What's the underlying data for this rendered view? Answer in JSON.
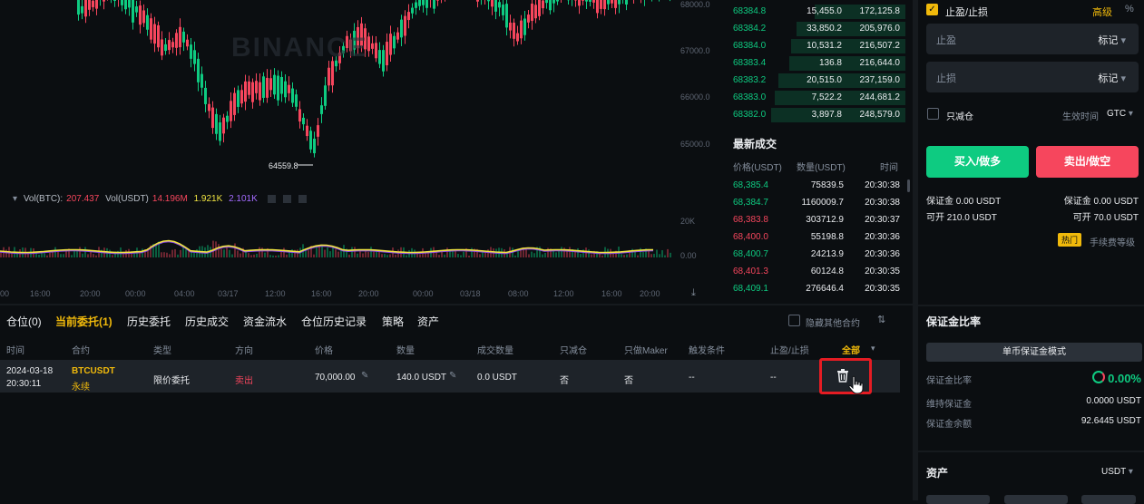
{
  "chart": {
    "price_ticks": [
      "68000.0",
      "67000.0",
      "66000.0",
      "65000.0"
    ],
    "low_marker": "64559.8",
    "watermark": "BINANCE",
    "vol_legend": {
      "title": "Vol(BTC):",
      "btc": "207.437",
      "usdt_label": "Vol(USDT)",
      "usdt": "14.196M",
      "ma1": "1.921K",
      "ma2": "2.101K"
    },
    "vol_ticks": [
      "20K",
      "0.00"
    ],
    "time_ticks": [
      "00",
      "16:00",
      "20:00",
      "00:00",
      "04:00",
      "03/17",
      "12:00",
      "16:00",
      "20:00",
      "00:00",
      "03/18",
      "08:00",
      "12:00",
      "16:00",
      "20:00"
    ],
    "colors": {
      "up": "#0ecb81",
      "down": "#f6465d",
      "vol_yellow": "#f0e442",
      "vol_purple": "#8c4ce6"
    }
  },
  "orderbook": {
    "bids": [
      {
        "price": "68384.8",
        "qty": "15,455.0",
        "total": "172,125.8",
        "depth": 0.5
      },
      {
        "price": "68384.2",
        "qty": "33,850.2",
        "total": "205,976.0",
        "depth": 0.6
      },
      {
        "price": "68384.0",
        "qty": "10,531.2",
        "total": "216,507.2",
        "depth": 0.63
      },
      {
        "price": "68383.4",
        "qty": "136.8",
        "total": "216,644.0",
        "depth": 0.64
      },
      {
        "price": "68383.2",
        "qty": "20,515.0",
        "total": "237,159.0",
        "depth": 0.7
      },
      {
        "price": "68383.0",
        "qty": "7,522.2",
        "total": "244,681.2",
        "depth": 0.72
      },
      {
        "price": "68382.0",
        "qty": "3,897.8",
        "total": "248,579.0",
        "depth": 0.74
      }
    ]
  },
  "trades": {
    "title": "最新成交",
    "hdr_price": "价格(USDT)",
    "hdr_qty": "数量(USDT)",
    "hdr_time": "时间",
    "rows": [
      {
        "price": "68,385.4",
        "qty": "75839.5",
        "time": "20:30:38",
        "side": "up"
      },
      {
        "price": "68,384.7",
        "qty": "1160009.7",
        "time": "20:30:38",
        "side": "up"
      },
      {
        "price": "68,383.8",
        "qty": "303712.9",
        "time": "20:30:37",
        "side": "down"
      },
      {
        "price": "68,400.0",
        "qty": "55198.8",
        "time": "20:30:36",
        "side": "down"
      },
      {
        "price": "68,400.7",
        "qty": "24213.9",
        "time": "20:30:36",
        "side": "up"
      },
      {
        "price": "68,401.3",
        "qty": "60124.8",
        "time": "20:30:35",
        "side": "down"
      },
      {
        "price": "68,409.1",
        "qty": "276646.4",
        "time": "20:30:35",
        "side": "up"
      }
    ]
  },
  "order_panel": {
    "tpsl_label": "止盈/止损",
    "advanced": "高级",
    "tp_label": "止盈",
    "tp_mode": "标记",
    "sl_label": "止损",
    "sl_mode": "标记",
    "reduce_only": "只减仓",
    "tif_label": "生效时间",
    "tif_value": "GTC",
    "buy": "买入/做多",
    "sell": "卖出/做空",
    "margin_left": "保证金 0.00 USDT",
    "margin_right": "保证金 0.00 USDT",
    "open_left": "可开 210.0 USDT",
    "open_right": "可开 70.0 USDT",
    "hot_badge": "热门",
    "fee_level": "手续费等级"
  },
  "margin": {
    "title": "保证金比率",
    "mode_button": "单币保证金模式",
    "ratio_label": "保证金比率",
    "ratio_value": "0.00%",
    "maint_label": "维持保证金",
    "maint_value": "0.0000 USDT",
    "balance_label": "保证金余额",
    "balance_value": "92.6445 USDT",
    "assets_title": "资产",
    "assets_currency": "USDT"
  },
  "bottom": {
    "tabs": [
      "仓位(0)",
      "当前委托(1)",
      "历史委托",
      "历史成交",
      "资金流水",
      "仓位历史记录",
      "策略",
      "资产"
    ],
    "active_tab": 1,
    "hide_other": "隐藏其他合约",
    "columns": [
      "时间",
      "合约",
      "类型",
      "方向",
      "价格",
      "数量",
      "成交数量",
      "只减仓",
      "只做Maker",
      "触发条件",
      "止盈/止损",
      "全部"
    ],
    "order": {
      "date": "2024-03-18",
      "time": "20:30:11",
      "symbol": "BTCUSDT",
      "perp": "永续",
      "type": "限价委托",
      "side": "卖出",
      "price": "70,000.00",
      "qty": "140.0 USDT",
      "filled": "0.0 USDT",
      "reduce_only": "否",
      "maker_only": "否",
      "trigger": "--",
      "tpsl": "--"
    }
  }
}
